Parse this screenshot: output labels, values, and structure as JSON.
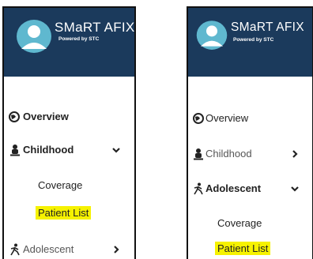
{
  "panels": [
    {
      "brand": {
        "title": "SMaRT AFIX",
        "subtitle": "Powered by STC"
      },
      "nav": {
        "overview": "Overview",
        "childhood": "Childhood",
        "adolescent": "Adolescent",
        "childhood_expanded": true,
        "adolescent_expanded": false
      },
      "submenu": {
        "coverage": "Coverage",
        "patient_list": "Patient List"
      }
    },
    {
      "brand": {
        "title": "SMaRT AFIX",
        "subtitle": "Powered by STC"
      },
      "nav": {
        "overview": "Overview",
        "childhood": "Childhood",
        "adolescent": "Adolescent",
        "childhood_expanded": false,
        "adolescent_expanded": true
      },
      "submenu": {
        "coverage": "Coverage",
        "patient_list": "Patient List"
      }
    }
  ],
  "colors": {
    "header": "#1b3a5c",
    "logo_teal": "#5fb8cf",
    "highlight": "#f6f200"
  },
  "icons": {
    "overview": "globe-icon",
    "childhood": "person-icon",
    "adolescent": "running-person-icon",
    "expanded": "chevron-down-icon",
    "collapsed": "chevron-right-icon"
  }
}
